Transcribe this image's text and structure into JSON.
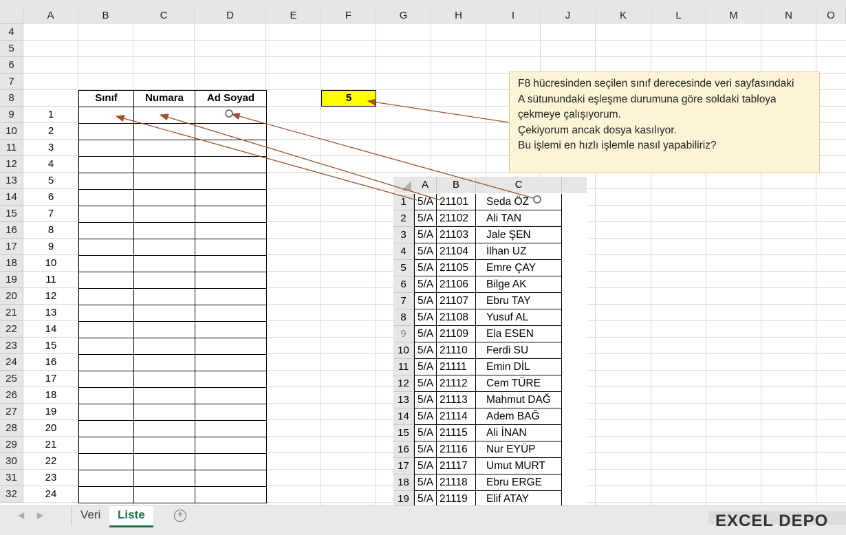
{
  "columns": [
    "A",
    "B",
    "C",
    "D",
    "E",
    "F",
    "G",
    "H",
    "I",
    "J",
    "K",
    "L",
    "M",
    "N",
    "O"
  ],
  "rows": [
    4,
    5,
    6,
    7,
    8,
    9,
    10,
    11,
    12,
    13,
    14,
    15,
    16,
    17,
    18,
    19,
    20,
    21,
    22,
    23,
    24,
    25,
    26,
    27,
    28,
    29,
    30,
    31,
    32
  ],
  "table": {
    "headers": {
      "sinif": "Sınıf",
      "numara": "Numara",
      "adsoyad": "Ad Soyad"
    },
    "index": [
      1,
      2,
      3,
      4,
      5,
      6,
      7,
      8,
      9,
      10,
      11,
      12,
      13,
      14,
      15,
      16,
      17,
      18,
      19,
      20,
      21,
      22,
      23,
      24
    ]
  },
  "f8_value": "5",
  "f8_color": "#ffff00",
  "callout": {
    "lines": [
      "F8 hücresinden seçilen sınıf derecesinde veri sayfasındaki",
      "A sütunundaki eşleşme durumuna göre soldaki tabloya",
      "çekmeye çalışıyorum.",
      "Çekiyorum ancak dosya kasılıyor.",
      "Bu işlemi en hızlı işlemle nasıl yapabiliriz?"
    ]
  },
  "veri": {
    "columns": [
      "A",
      "B",
      "C"
    ],
    "rows": [
      {
        "n": "1",
        "a": "5/A",
        "b": "21101",
        "c": "Seda ÖZ"
      },
      {
        "n": "2",
        "a": "5/A",
        "b": "21102",
        "c": "Ali TAN"
      },
      {
        "n": "3",
        "a": "5/A",
        "b": "21103",
        "c": "Jale ŞEN"
      },
      {
        "n": "4",
        "a": "5/A",
        "b": "21104",
        "c": "İlhan UZ"
      },
      {
        "n": "5",
        "a": "5/A",
        "b": "21105",
        "c": "Emre ÇAY"
      },
      {
        "n": "6",
        "a": "5/A",
        "b": "21106",
        "c": "Bilge AK"
      },
      {
        "n": "7",
        "a": "5/A",
        "b": "21107",
        "c": "Ebru TAY"
      },
      {
        "n": "8",
        "a": "5/A",
        "b": "21108",
        "c": "Yusuf AL"
      },
      {
        "n": "9",
        "a": "5/A",
        "b": "21109",
        "c": "Ela ESEN"
      },
      {
        "n": "10",
        "a": "5/A",
        "b": "21110",
        "c": "Ferdi SU"
      },
      {
        "n": "11",
        "a": "5/A",
        "b": "21111",
        "c": "Emin DİL"
      },
      {
        "n": "12",
        "a": "5/A",
        "b": "21112",
        "c": "Cem TÜRE"
      },
      {
        "n": "13",
        "a": "5/A",
        "b": "21113",
        "c": "Mahmut DAĞ"
      },
      {
        "n": "14",
        "a": "5/A",
        "b": "21114",
        "c": "Adem BAĞ"
      },
      {
        "n": "15",
        "a": "5/A",
        "b": "21115",
        "c": "Ali İNAN"
      },
      {
        "n": "16",
        "a": "5/A",
        "b": "21116",
        "c": "Nur EYÜP"
      },
      {
        "n": "17",
        "a": "5/A",
        "b": "21117",
        "c": "Umut MURT"
      },
      {
        "n": "18",
        "a": "5/A",
        "b": "21118",
        "c": "Ebru ERGE"
      },
      {
        "n": "19",
        "a": "5/A",
        "b": "21119",
        "c": "Elif ATAY"
      }
    ]
  },
  "tabs": [
    "Veri",
    "Liste"
  ],
  "active_tab": "Liste",
  "add_sheet_icon": "plus-circle-icon",
  "watermark": "EXCEL DEPO",
  "accent_color": "#1e7145",
  "arrow_color": "#a0522d"
}
